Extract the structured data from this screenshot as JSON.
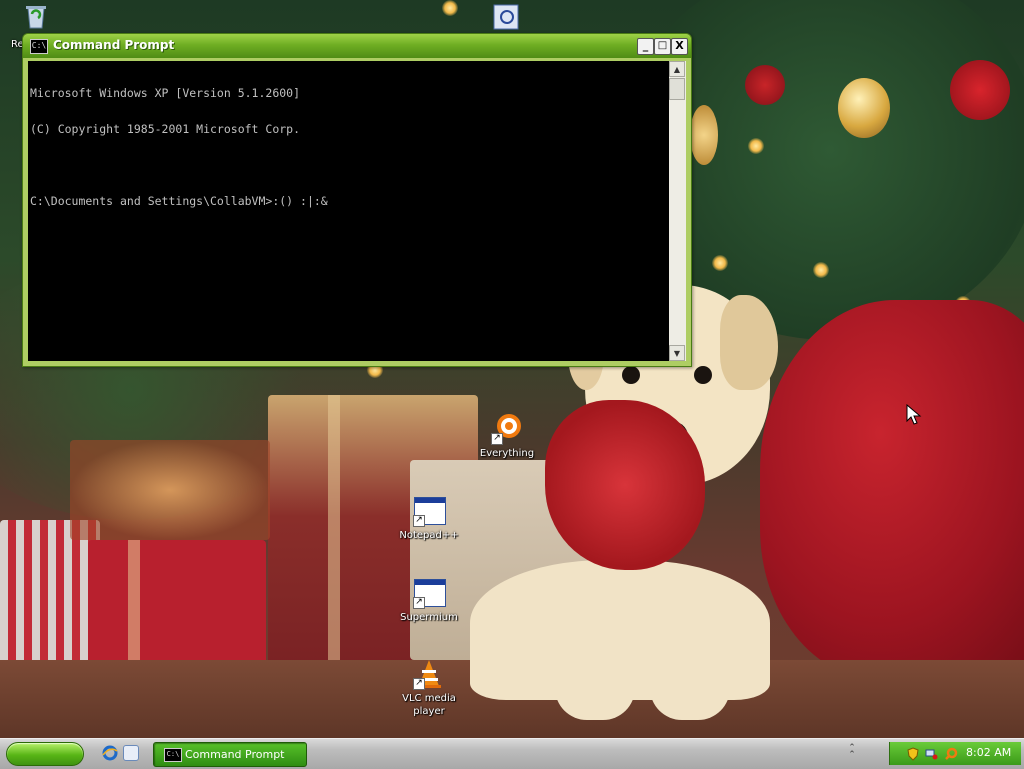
{
  "desktop": {
    "icons": [
      {
        "label": "Re",
        "name": "recycle-bin"
      },
      {
        "label": "Everything",
        "name": "everything"
      },
      {
        "label": "Notepad++",
        "name": "notepadpp"
      },
      {
        "label": "Supermium",
        "name": "supermium"
      },
      {
        "label": "VLC media player",
        "name": "vlc"
      }
    ]
  },
  "window": {
    "title": "Command Prompt",
    "controls": {
      "minimize": "_",
      "maximize": "□",
      "close": "X"
    },
    "console_lines": [
      "Microsoft Windows XP [Version 5.1.2600]",
      "(C) Copyright 1985-2001 Microsoft Corp.",
      "",
      "C:\\Documents and Settings\\CollabVM>:() :|:&"
    ]
  },
  "taskbar": {
    "task_button_label": "Command Prompt",
    "clock": "8:02 AM"
  },
  "colors": {
    "titlebar": "#6fae23",
    "taskbar_task": "#2f8d12",
    "tray": "#3a9a18"
  }
}
